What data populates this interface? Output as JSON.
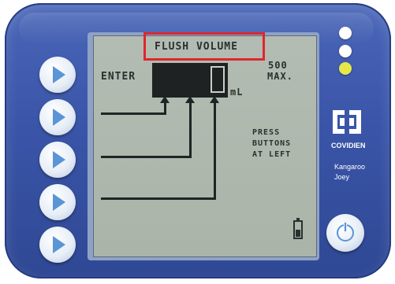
{
  "screen": {
    "title": "FLUSH VOLUME",
    "prompt_label": "ENTER",
    "unit": "mL",
    "max_value": "500",
    "max_label": "MAX.",
    "instruction_lines": [
      "PRESS",
      "BUTTONS",
      "AT LEFT"
    ]
  },
  "side_buttons": [
    {
      "icon": "play-triangle-icon"
    },
    {
      "icon": "play-triangle-icon"
    },
    {
      "icon": "play-triangle-icon"
    },
    {
      "icon": "play-triangle-icon"
    },
    {
      "icon": "play-triangle-icon"
    }
  ],
  "status_lights": [
    {
      "name": "indicator-light-1",
      "color": "#ffffff"
    },
    {
      "name": "indicator-light-2",
      "color": "#ffffff"
    },
    {
      "name": "indicator-light-3",
      "color": "#e6e84a"
    }
  ],
  "brand": {
    "company": "COVIDIEN",
    "product_line1": "Kangaroo",
    "product_line2": "Joey"
  },
  "colors": {
    "device_blue": "#3a55a8",
    "lcd_background": "#aeb8ad",
    "highlight_red": "#e0262b",
    "button_arrow_blue": "#5a95d6"
  }
}
